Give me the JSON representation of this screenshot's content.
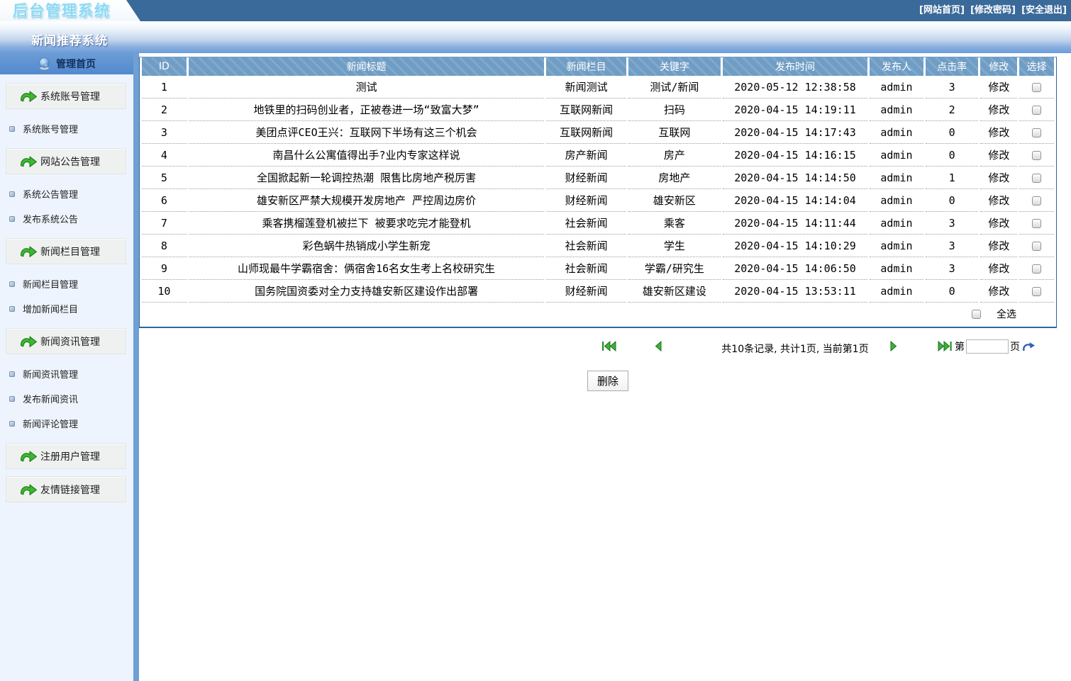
{
  "header": {
    "logo": "后台管理系统",
    "subtitle": "新闻推荐系统",
    "links": [
      {
        "label": "[网站首页]"
      },
      {
        "label": "[修改密码]"
      },
      {
        "label": "[安全退出]"
      }
    ]
  },
  "sidebar": {
    "home_label": "管理首页",
    "menu": [
      {
        "type": "section",
        "label": "系统账号管理"
      },
      {
        "type": "item",
        "label": "系统账号管理"
      },
      {
        "type": "section",
        "label": "网站公告管理"
      },
      {
        "type": "item",
        "label": "系统公告管理"
      },
      {
        "type": "item",
        "label": "发布系统公告"
      },
      {
        "type": "section",
        "label": "新闻栏目管理"
      },
      {
        "type": "item",
        "label": "新闻栏目管理"
      },
      {
        "type": "item",
        "label": "增加新闻栏目"
      },
      {
        "type": "section",
        "label": "新闻资讯管理"
      },
      {
        "type": "item",
        "label": "新闻资讯管理"
      },
      {
        "type": "item",
        "label": "发布新闻资讯"
      },
      {
        "type": "item",
        "label": "新闻评论管理"
      },
      {
        "type": "section",
        "label": "注册用户管理"
      },
      {
        "type": "section",
        "label": "友情链接管理"
      }
    ]
  },
  "table": {
    "headers": [
      "ID",
      "新闻标题",
      "新闻栏目",
      "关键字",
      "发布时间",
      "发布人",
      "点击率",
      "修改",
      "选择"
    ],
    "edit_label": "修改",
    "select_all_label": "全选",
    "rows": [
      {
        "id": "1",
        "title": "测试",
        "category": "新闻测试",
        "keyword": "测试/新闻",
        "time": "2020-05-12 12:38:58",
        "publisher": "admin",
        "clicks": "3"
      },
      {
        "id": "2",
        "title": "地铁里的扫码创业者，正被卷进一场“致富大梦”",
        "category": "互联网新闻",
        "keyword": "扫码",
        "time": "2020-04-15 14:19:11",
        "publisher": "admin",
        "clicks": "2"
      },
      {
        "id": "3",
        "title": "美团点评CEO王兴：互联网下半场有这三个机会",
        "category": "互联网新闻",
        "keyword": "互联网",
        "time": "2020-04-15 14:17:43",
        "publisher": "admin",
        "clicks": "0"
      },
      {
        "id": "4",
        "title": "南昌什么公寓值得出手?业内专家这样说",
        "category": "房产新闻",
        "keyword": "房产",
        "time": "2020-04-15 14:16:15",
        "publisher": "admin",
        "clicks": "0"
      },
      {
        "id": "5",
        "title": "全国掀起新一轮调控热潮 限售比房地产税厉害",
        "category": "财经新闻",
        "keyword": "房地产",
        "time": "2020-04-15 14:14:50",
        "publisher": "admin",
        "clicks": "1"
      },
      {
        "id": "6",
        "title": "雄安新区严禁大规模开发房地产 严控周边房价",
        "category": "财经新闻",
        "keyword": "雄安新区",
        "time": "2020-04-15 14:14:04",
        "publisher": "admin",
        "clicks": "0"
      },
      {
        "id": "7",
        "title": "乘客携榴莲登机被拦下 被要求吃完才能登机",
        "category": "社会新闻",
        "keyword": "乘客",
        "time": "2020-04-15 14:11:44",
        "publisher": "admin",
        "clicks": "3"
      },
      {
        "id": "8",
        "title": "彩色蜗牛热销成小学生新宠",
        "category": "社会新闻",
        "keyword": "学生",
        "time": "2020-04-15 14:10:29",
        "publisher": "admin",
        "clicks": "3"
      },
      {
        "id": "9",
        "title": "山师现最牛学霸宿舍：俩宿舍16名女生考上名校研究生",
        "category": "社会新闻",
        "keyword": "学霸/研究生",
        "time": "2020-04-15 14:06:50",
        "publisher": "admin",
        "clicks": "3"
      },
      {
        "id": "10",
        "title": "国务院国资委对全力支持雄安新区建设作出部署",
        "category": "财经新闻",
        "keyword": "雄安新区建设",
        "time": "2020-04-15 13:53:11",
        "publisher": "admin",
        "clicks": "0"
      }
    ]
  },
  "pagination": {
    "summary": "共10条记录, 共计1页, 当前第1页",
    "goto_prefix": "第",
    "goto_suffix": "页",
    "page_input_value": "",
    "icons": [
      "first-page-icon",
      "prev-page-icon",
      "next-page-icon",
      "last-page-icon",
      "go-page-icon"
    ]
  },
  "actions": {
    "delete_label": "删除"
  },
  "colors": {
    "topbar": "#3a6a99",
    "band_bottom": "#6b9cd6",
    "sidebar_bg": "#edf4fd",
    "sidebar_strip": "#6fa0d4",
    "table_header": "#6f9dc4",
    "table_border": "#31639f",
    "nav_arrow_green": "#3db13d",
    "menu_arrow_green": "#3cb832",
    "go_arrow_blue": "#2f5fc0",
    "logo_cyan": "#8ed9f2"
  }
}
